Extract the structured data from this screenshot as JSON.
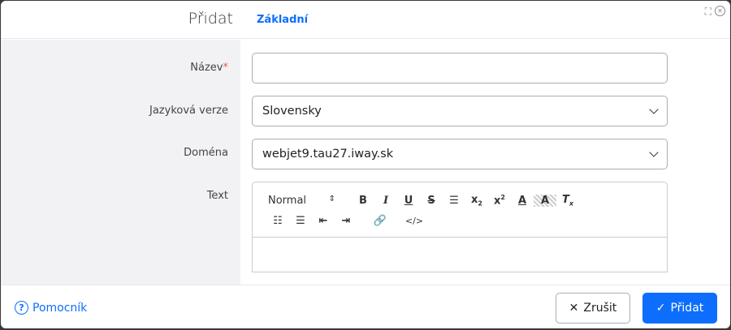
{
  "header": {
    "title": "Přidat",
    "tab": "Základní"
  },
  "form": {
    "name_label": "Název",
    "name_required": "*",
    "name_value": "",
    "lang_label": "Jazyková verze",
    "lang_value": "Slovensky",
    "domain_label": "Doména",
    "domain_value": "webjet9.tau27.iway.sk",
    "text_label": "Text"
  },
  "editor": {
    "format": "Normal"
  },
  "footer": {
    "help": "Pomocník",
    "cancel": "Zrušit",
    "submit": "Přidat"
  }
}
